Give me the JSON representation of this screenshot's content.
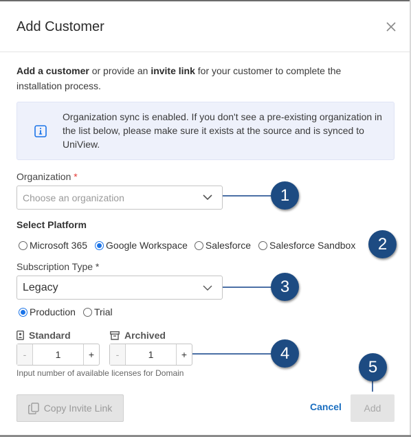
{
  "modal": {
    "title": "Add Customer"
  },
  "intro": {
    "bold1": "Add a customer",
    "text1": " or provide an ",
    "bold2": "invite link",
    "text2": " for your customer to complete the installation process."
  },
  "info": {
    "text": "Organization sync is enabled. If you don't see a pre-existing organization in the list below, please make sure it exists at the source and is synced to UniView."
  },
  "organization": {
    "label": "Organization",
    "required_mark": "*",
    "placeholder": "Choose an organization"
  },
  "platform": {
    "label": "Select Platform",
    "options": [
      "Microsoft 365",
      "Google Workspace",
      "Salesforce",
      "Salesforce Sandbox"
    ],
    "selected": "Google Workspace"
  },
  "subscription": {
    "label": "Subscription Type *",
    "value": "Legacy",
    "modes": [
      "Production",
      "Trial"
    ],
    "selected_mode": "Production"
  },
  "licenses": {
    "standard": {
      "label": "Standard",
      "value": "1",
      "minus": "-",
      "plus": "+"
    },
    "archived": {
      "label": "Archived",
      "value": "1",
      "minus": "-",
      "plus": "+"
    },
    "hint": "Input number of available licenses for Domain"
  },
  "footer": {
    "copy_invite_label": "Copy Invite Link",
    "cancel_label": "Cancel",
    "add_label": "Add"
  },
  "callouts": [
    "1",
    "2",
    "3",
    "4",
    "5"
  ],
  "colors": {
    "accent": "#1a73e8",
    "callout": "#1d4b82",
    "info_bg": "#eef1fb",
    "link": "#1a6ec0"
  }
}
